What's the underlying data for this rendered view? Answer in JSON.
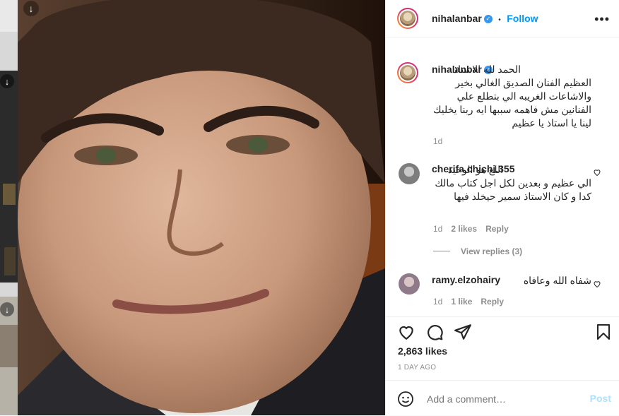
{
  "post": {
    "username": "nihalanbar",
    "follow_label": "Follow",
    "separator": "•",
    "more_label": "•••",
    "caption": "الحمد لله الاستاذ العظيم الفنان الصديق الغالي بخير والاشاعات الغريبه الي بتطلع علي الفنانين مش فاهمه سببها ايه ربنا يخليك لينا يا استاذ يا عظيم",
    "caption_time": "1d",
    "likes": "2,863 likes",
    "date": "1 DAY AGO"
  },
  "comments": [
    {
      "username": "cherifa.chichi.355",
      "text": "اللع هو الوحيد الي عظيم و بعدين لكل اجل كتاب مالك كدا و كان الاستاذ سمير حيخلد فيها",
      "time": "1d",
      "likes": "2 likes",
      "reply": "Reply",
      "view_replies": "View replies (3)"
    },
    {
      "username": "ramy.elzohairy",
      "text": "شفاه الله وعافاه",
      "time": "1d",
      "likes": "1 like",
      "reply": "Reply"
    }
  ],
  "add_comment": {
    "placeholder": "Add a comment…",
    "post_label": "Post"
  },
  "colors": {
    "accent": "#0095f6",
    "muted": "#8e8e8e",
    "verified": "#3897f0"
  }
}
